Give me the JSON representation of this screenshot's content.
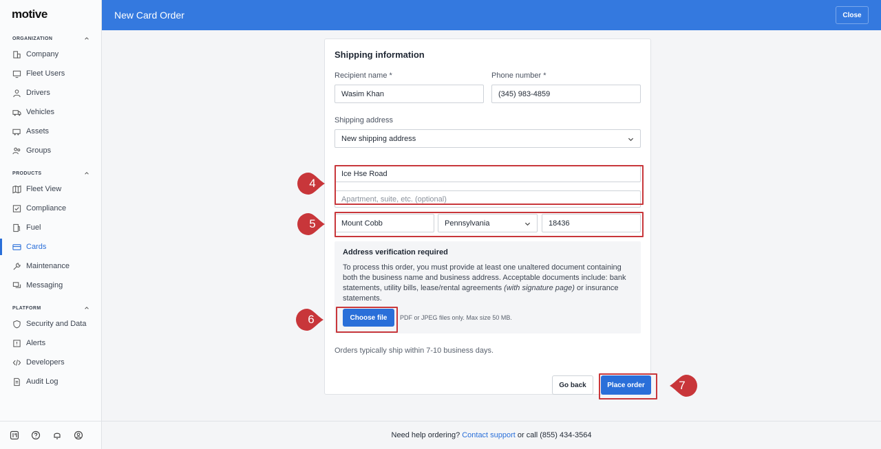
{
  "brand": {
    "logo_text": "motive"
  },
  "sidebar": {
    "sections": [
      {
        "label": "ORGANIZATION"
      },
      {
        "label": "PRODUCTS"
      },
      {
        "label": "PLATFORM"
      }
    ],
    "items": [
      {
        "label": "Company",
        "icon": "building-icon"
      },
      {
        "label": "Fleet Users",
        "icon": "monitor-icon"
      },
      {
        "label": "Drivers",
        "icon": "person-icon"
      },
      {
        "label": "Vehicles",
        "icon": "truck-icon"
      },
      {
        "label": "Assets",
        "icon": "trailer-icon"
      },
      {
        "label": "Groups",
        "icon": "group-icon"
      },
      {
        "label": "Fleet View",
        "icon": "map-icon"
      },
      {
        "label": "Compliance",
        "icon": "compliance-icon"
      },
      {
        "label": "Fuel",
        "icon": "fuel-icon"
      },
      {
        "label": "Cards",
        "icon": "card-icon",
        "active": true
      },
      {
        "label": "Maintenance",
        "icon": "wrench-icon"
      },
      {
        "label": "Messaging",
        "icon": "message-icon"
      },
      {
        "label": "Security and Data",
        "icon": "shield-icon"
      },
      {
        "label": "Alerts",
        "icon": "alert-icon"
      },
      {
        "label": "Developers",
        "icon": "code-icon"
      },
      {
        "label": "Audit Log",
        "icon": "document-icon"
      }
    ],
    "footer_icons": [
      "dashboard-icon",
      "help-icon",
      "bell-icon",
      "user-icon"
    ]
  },
  "header": {
    "title": "New Card Order",
    "close_label": "Close"
  },
  "form": {
    "title": "Shipping information",
    "recipient_label": "Recipient name *",
    "recipient_value": "Wasim Khan",
    "phone_label": "Phone number *",
    "phone_value": "(345) 983-4859",
    "shipping_address_label": "Shipping address",
    "shipping_address_value": "New shipping address",
    "street_value": "Ice Hse Road",
    "apartment_placeholder": "Apartment, suite, etc. (optional)",
    "city_value": "Mount Cobb",
    "state_value": "Pennsylvania",
    "zip_value": "18436",
    "verification": {
      "title": "Address verification required",
      "text_before": "To process this order, you must provide at least one unaltered document containing both the business name and business address. Acceptable documents include: bank statements, utility bills, lease/rental agreements ",
      "text_italic": "(with signature page)",
      "text_after": " or insurance statements.",
      "choose_file_label": "Choose file",
      "file_hint": "PDF or JPEG files only. Max size 50 MB."
    },
    "ship_note": "Orders typically ship within 7-10 business days."
  },
  "actions": {
    "go_back_label": "Go back",
    "place_order_label": "Place order"
  },
  "footer": {
    "text_before": "Need help ordering?",
    "link_label": "Contact support",
    "text_after": "or call (855) 434-3564"
  },
  "annotations": [
    "4",
    "5",
    "6",
    "7"
  ],
  "colors": {
    "header": "#3479df",
    "primary": "#2a6fd9",
    "annotation": "#c8363a"
  }
}
